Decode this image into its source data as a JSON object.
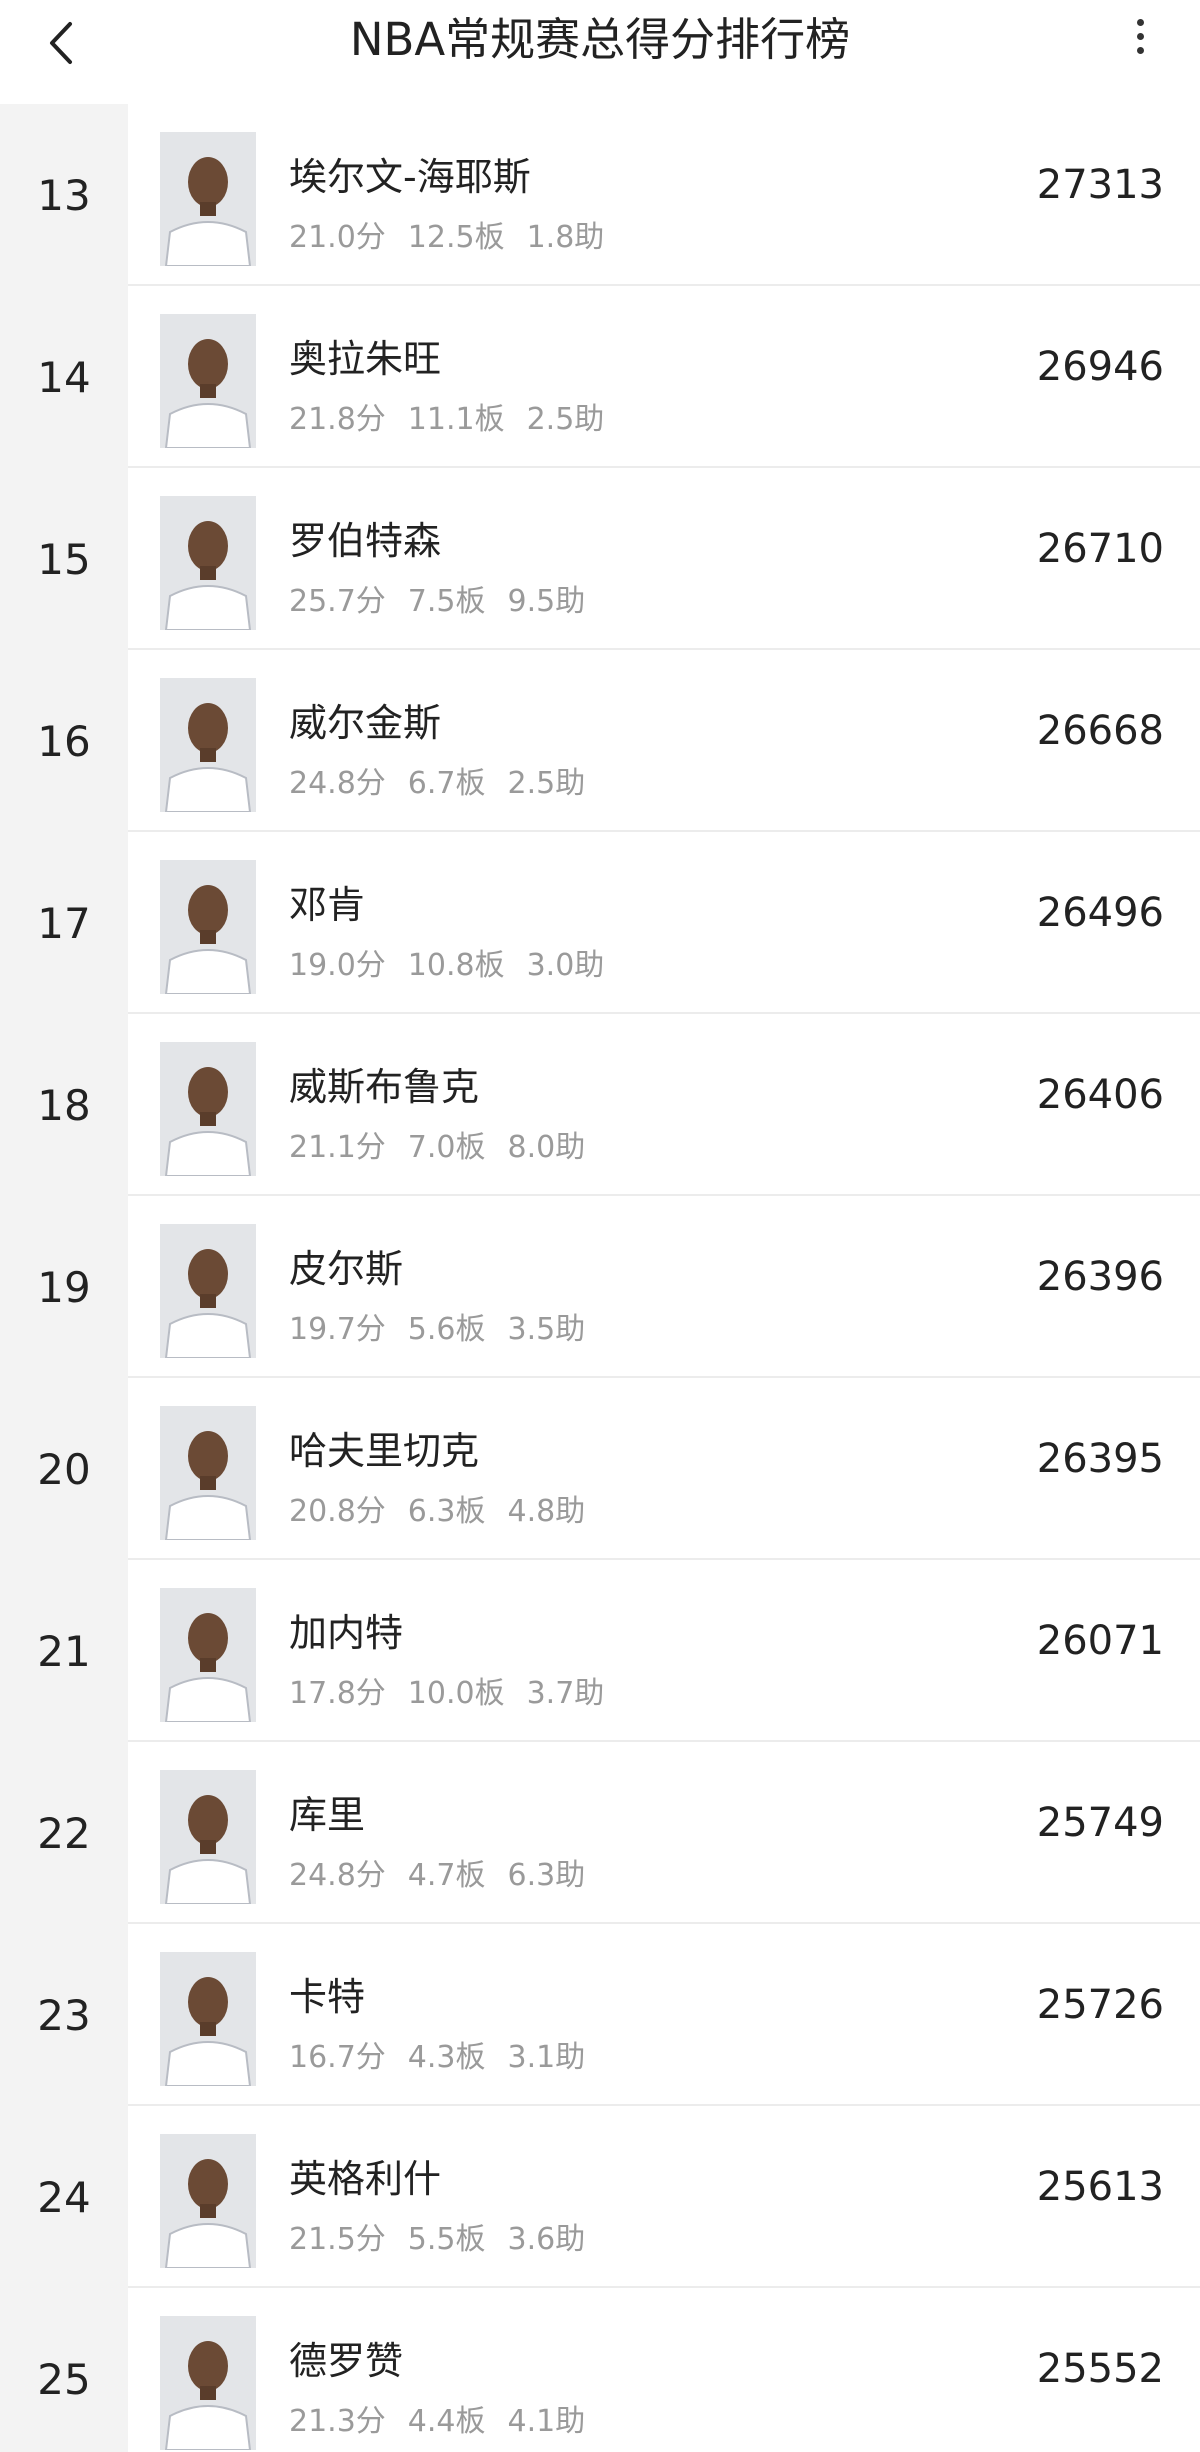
{
  "header": {
    "title": "NBA常规赛总得分排行榜"
  },
  "players": [
    {
      "rank": "13",
      "name": "埃尔文-海耶斯",
      "ppg": "21.0分",
      "rpg": "12.5板",
      "apg": "1.8助",
      "points": "27313"
    },
    {
      "rank": "14",
      "name": "奥拉朱旺",
      "ppg": "21.8分",
      "rpg": "11.1板",
      "apg": "2.5助",
      "points": "26946"
    },
    {
      "rank": "15",
      "name": "罗伯特森",
      "ppg": "25.7分",
      "rpg": "7.5板",
      "apg": "9.5助",
      "points": "26710"
    },
    {
      "rank": "16",
      "name": "威尔金斯",
      "ppg": "24.8分",
      "rpg": "6.7板",
      "apg": "2.5助",
      "points": "26668"
    },
    {
      "rank": "17",
      "name": "邓肯",
      "ppg": "19.0分",
      "rpg": "10.8板",
      "apg": "3.0助",
      "points": "26496"
    },
    {
      "rank": "18",
      "name": "威斯布鲁克",
      "ppg": "21.1分",
      "rpg": "7.0板",
      "apg": "8.0助",
      "points": "26406"
    },
    {
      "rank": "19",
      "name": "皮尔斯",
      "ppg": "19.7分",
      "rpg": "5.6板",
      "apg": "3.5助",
      "points": "26396"
    },
    {
      "rank": "20",
      "name": "哈夫里切克",
      "ppg": "20.8分",
      "rpg": "6.3板",
      "apg": "4.8助",
      "points": "26395"
    },
    {
      "rank": "21",
      "name": "加内特",
      "ppg": "17.8分",
      "rpg": "10.0板",
      "apg": "3.7助",
      "points": "26071"
    },
    {
      "rank": "22",
      "name": "库里",
      "ppg": "24.8分",
      "rpg": "4.7板",
      "apg": "6.3助",
      "points": "25749"
    },
    {
      "rank": "23",
      "name": "卡特",
      "ppg": "16.7分",
      "rpg": "4.3板",
      "apg": "3.1助",
      "points": "25726"
    },
    {
      "rank": "24",
      "name": "英格利什",
      "ppg": "21.5分",
      "rpg": "5.5板",
      "apg": "3.6助",
      "points": "25613"
    },
    {
      "rank": "25",
      "name": "德罗赞",
      "ppg": "21.3分",
      "rpg": "4.4板",
      "apg": "4.1助",
      "points": "25552"
    }
  ],
  "icons": {
    "back": "chevron-left-icon",
    "more": "more-vertical-icon",
    "avatar": "player-avatar-icon"
  },
  "colors": {
    "rank_background": "#f3f3f3",
    "stats_text": "#9a9a9a",
    "divider": "#ececec"
  }
}
